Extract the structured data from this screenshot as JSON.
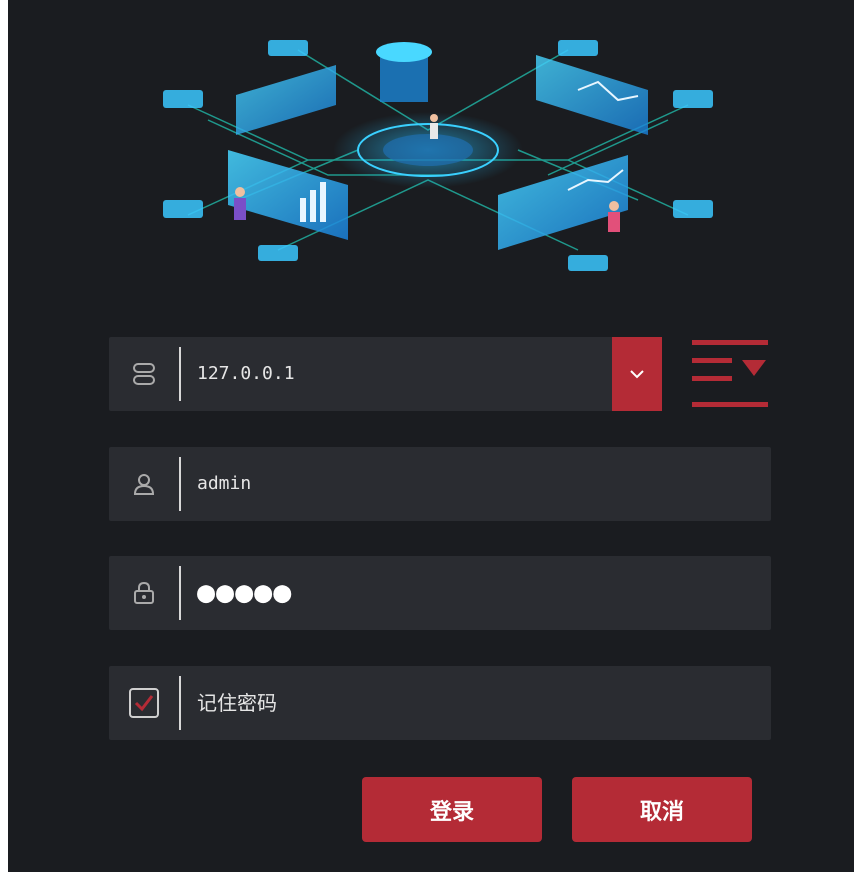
{
  "server": {
    "value": "127.0.0.1"
  },
  "user": {
    "value": "admin"
  },
  "password": {
    "masked": "●●●●●"
  },
  "remember": {
    "label": "记住密码",
    "checked": true
  },
  "buttons": {
    "login": "登录",
    "cancel": "取消"
  },
  "colors": {
    "accent": "#b42b36",
    "panel": "#2a2c31",
    "bg": "#1a1c20",
    "cyan": "#27c3ff"
  },
  "icons": {
    "server": "server-icon",
    "user": "user-icon",
    "lock": "lock-icon",
    "checkbox": "checkbox-icon",
    "dropdown": "chevron-down-icon",
    "list": "list-dropdown-icon"
  }
}
